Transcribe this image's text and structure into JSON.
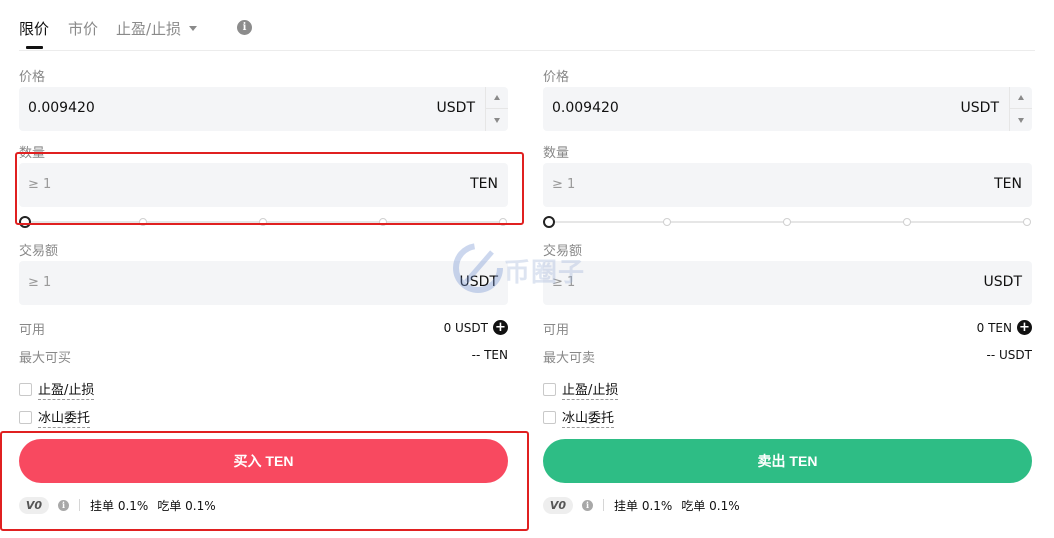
{
  "tabs": {
    "limit": "限价",
    "market": "市价",
    "tpsl": "止盈/止损"
  },
  "buy": {
    "price_label": "价格",
    "price_value": "0.009420",
    "price_unit": "USDT",
    "amount_label": "数量",
    "amount_placeholder": "≥ 1",
    "amount_unit": "TEN",
    "slider_percent": 0,
    "total_label": "交易额",
    "total_placeholder": "≥ 1",
    "total_unit": "USDT",
    "available_label": "可用",
    "available_value": "0 USDT",
    "max_label": "最大可买",
    "max_value": "-- TEN",
    "tpsl_label": "止盈/止损",
    "iceberg_label": "冰山委托",
    "button_label": "买入 TEN"
  },
  "sell": {
    "price_label": "价格",
    "price_value": "0.009420",
    "price_unit": "USDT",
    "amount_label": "数量",
    "amount_placeholder": "≥ 1",
    "amount_unit": "TEN",
    "slider_percent": 0,
    "total_label": "交易额",
    "total_placeholder": "≥ 1",
    "total_unit": "USDT",
    "available_label": "可用",
    "available_value": "0 TEN",
    "max_label": "最大可卖",
    "max_value": "-- USDT",
    "tpsl_label": "止盈/止损",
    "iceberg_label": "冰山委托",
    "button_label": "卖出 TEN"
  },
  "fees": {
    "vip_level": "V0",
    "maker": "挂单 0.1%",
    "taker": "吃单 0.1%"
  },
  "watermark_text": "币圈子",
  "colors": {
    "buy": "#f84960",
    "sell": "#2ebd85",
    "highlight": "#e02020"
  }
}
